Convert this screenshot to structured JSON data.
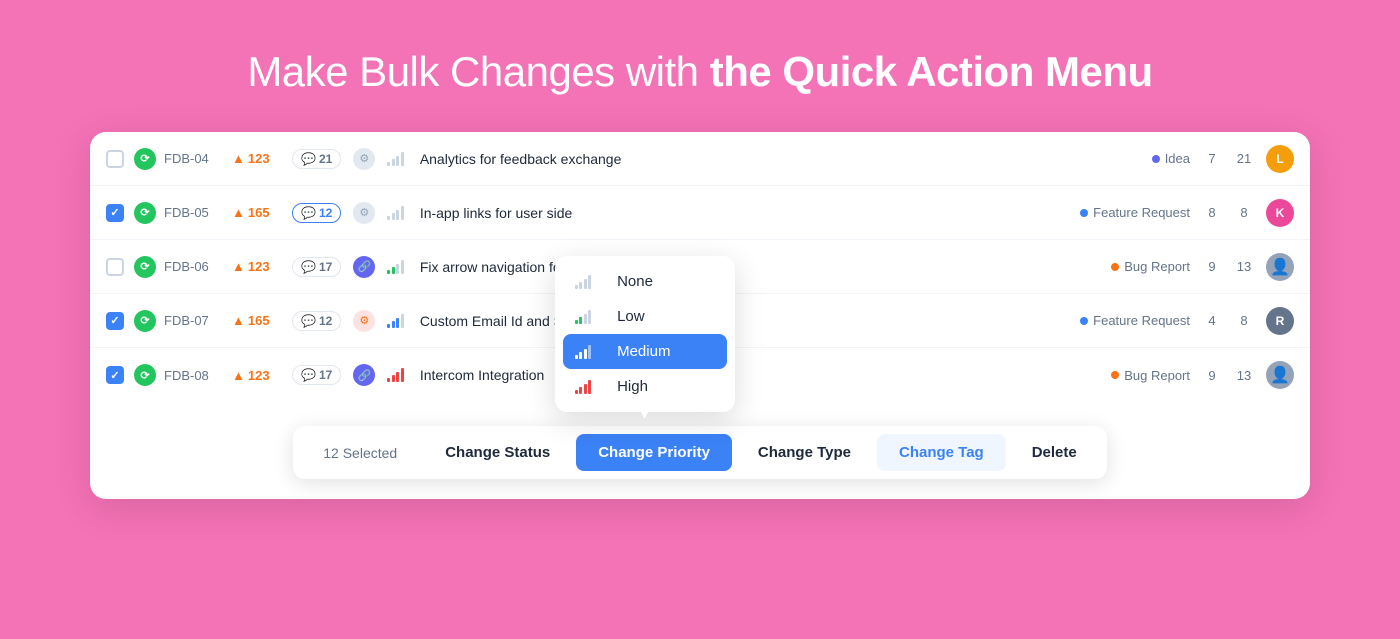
{
  "hero": {
    "title_normal": "Make Bulk Changes with ",
    "title_bold": "the Quick Action Menu"
  },
  "rows": [
    {
      "id": "FDB-04",
      "checked": false,
      "status_color": "#22c55e",
      "upvotes": "123",
      "comments": "21",
      "comments_highlight": false,
      "has_link": false,
      "bar_type": "bar-gray",
      "title": "Analytics for feedback exchange",
      "tag": "Idea",
      "tag_color": "#6366f1",
      "count1": "7",
      "count2": "21",
      "avatar_text": "L",
      "avatar_color": "#f59e0b"
    },
    {
      "id": "FDB-05",
      "checked": true,
      "status_color": "#22c55e",
      "upvotes": "165",
      "comments": "12",
      "comments_highlight": true,
      "has_link": false,
      "bar_type": "bar-gray",
      "title": "In-app links for user side",
      "tag": "Feature Request",
      "tag_color": "#3b82f6",
      "count1": "8",
      "count2": "8",
      "avatar_text": "K",
      "avatar_color": "#ec4899"
    },
    {
      "id": "FDB-06",
      "checked": false,
      "status_color": "#22c55e",
      "upvotes": "123",
      "comments": "17",
      "comments_highlight": false,
      "has_link": true,
      "bar_type": "bar-green",
      "title": "Fix arrow navigation for surveys",
      "tag": "Bug Report",
      "tag_color": "#f97316",
      "count1": "9",
      "count2": "13",
      "avatar_type": "img",
      "avatar_color": "#94a3b8"
    },
    {
      "id": "FDB-07",
      "checked": true,
      "status_color": "#22c55e",
      "upvotes": "165",
      "comments": "12",
      "comments_highlight": false,
      "has_link": false,
      "bar_type": "bar-blue",
      "title": "Custom Email Id and SMTP",
      "tag": "Feature Request",
      "tag_color": "#3b82f6",
      "count1": "4",
      "count2": "8",
      "avatar_text": "R",
      "avatar_color": "#64748b"
    },
    {
      "id": "FDB-08",
      "checked": true,
      "status_color": "#22c55e",
      "upvotes": "123",
      "comments": "17",
      "comments_highlight": false,
      "has_link": true,
      "bar_type": "bar-red",
      "title": "Intercom Integration",
      "tag": "Bug Report",
      "tag_color": "#f97316",
      "count1": "9",
      "count2": "13",
      "avatar_type": "img",
      "avatar_color": "#94a3b8"
    }
  ],
  "action_bar": {
    "selected": "12 Selected",
    "change_status": "Change Status",
    "change_priority": "Change Priority",
    "change_type": "Change Type",
    "change_tag": "Change Tag",
    "delete": "Delete"
  },
  "priority_dropdown": {
    "items": [
      {
        "label": "None",
        "bar": "none"
      },
      {
        "label": "Low",
        "bar": "low"
      },
      {
        "label": "Medium",
        "bar": "medium",
        "active": true
      },
      {
        "label": "High",
        "bar": "high"
      }
    ]
  }
}
